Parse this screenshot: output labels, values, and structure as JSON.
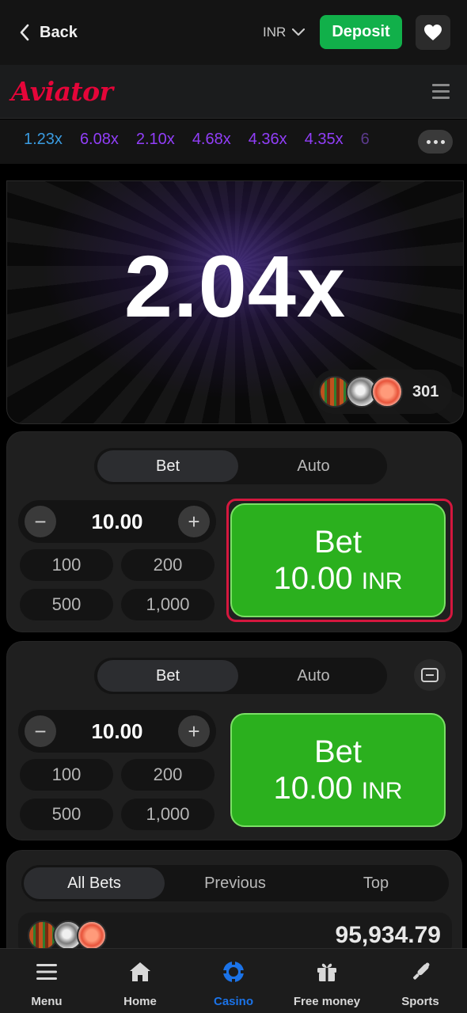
{
  "topbar": {
    "back_label": "Back",
    "currency": "INR",
    "deposit_label": "Deposit"
  },
  "game_header": {
    "logo": "Aviator"
  },
  "history": [
    {
      "value": "1.23x",
      "color": "#3a9be0"
    },
    {
      "value": "6.08x",
      "color": "#913ef8"
    },
    {
      "value": "2.10x",
      "color": "#913ef8"
    },
    {
      "value": "4.68x",
      "color": "#913ef8"
    },
    {
      "value": "4.36x",
      "color": "#913ef8"
    },
    {
      "value": "4.35x",
      "color": "#913ef8"
    },
    {
      "value": "6",
      "color": "#5b3a8c"
    }
  ],
  "game": {
    "multiplier": "2.04x",
    "players_count": "301"
  },
  "bet_panels": [
    {
      "tab_bet": "Bet",
      "tab_auto": "Auto",
      "amount": "10.00",
      "quick": [
        "100",
        "200",
        "500",
        "1,000"
      ],
      "button_line1": "Bet",
      "button_amount": "10.00",
      "button_currency": "INR"
    },
    {
      "tab_bet": "Bet",
      "tab_auto": "Auto",
      "amount": "10.00",
      "quick": [
        "100",
        "200",
        "500",
        "1,000"
      ],
      "button_line1": "Bet",
      "button_amount": "10.00",
      "button_currency": "INR"
    }
  ],
  "bets_list": {
    "tabs": [
      "All Bets",
      "Previous",
      "Top"
    ],
    "total": "95,934.79"
  },
  "bottom_nav": [
    {
      "label": "Menu",
      "icon": "menu-icon"
    },
    {
      "label": "Home",
      "icon": "home-icon"
    },
    {
      "label": "Casino",
      "icon": "casino-chip-icon",
      "active": true
    },
    {
      "label": "Free money",
      "icon": "gift-icon"
    },
    {
      "label": "Sports",
      "icon": "sports-icon"
    }
  ],
  "colors": {
    "deposit": "#11b04a",
    "bet_button": "#2bb01e",
    "logo": "#e50539",
    "highlight": "#d5173e",
    "active_nav": "#1b73e8"
  }
}
